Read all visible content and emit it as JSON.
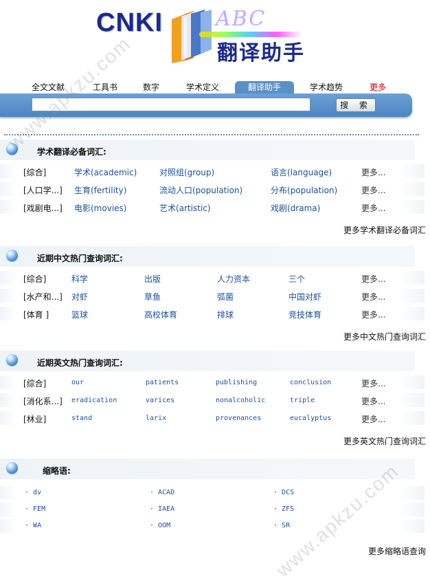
{
  "logo": {
    "brand": "CNKI",
    "abc": "ABC",
    "subtitle": "翻译助手"
  },
  "nav": {
    "tabs": [
      {
        "label": "全文文献"
      },
      {
        "label": "工具书"
      },
      {
        "label": "数字"
      },
      {
        "label": "学术定义"
      },
      {
        "label": "翻译助手",
        "active": true
      },
      {
        "label": "学术趋势"
      },
      {
        "label": "更多"
      }
    ]
  },
  "search": {
    "value": "",
    "button_label": "搜 索"
  },
  "sections": [
    {
      "title": "学术翻译必备词汇:",
      "rows": [
        {
          "category": "[综合]",
          "terms": [
            "学术(academic)",
            "对照组(group)",
            "语言(language)"
          ],
          "more": "更多..."
        },
        {
          "category": "[人口学...]",
          "terms": [
            "生育(fertility)",
            "流动人口(population)",
            "分布(population)"
          ],
          "more": "更多..."
        },
        {
          "category": "[戏剧电...]",
          "terms": [
            "电影(movies)",
            "艺术(artistic)",
            "戏剧(drama)"
          ],
          "more": "更多..."
        }
      ],
      "more_link": "更多学术翻译必备词汇"
    },
    {
      "title": "近期中文热门查询词汇:",
      "rows": [
        {
          "category": "[综合]",
          "terms": [
            "科学",
            "出版",
            "人力资本",
            "三个"
          ],
          "more": "更多..."
        },
        {
          "category": "[水产和...]",
          "terms": [
            "对虾",
            "草鱼",
            "弧菌",
            "中国对虾"
          ],
          "more": "更多..."
        },
        {
          "category": "[体育 ]",
          "terms": [
            "篮球",
            "高校体育",
            "排球",
            "竞技体育"
          ],
          "more": "更多..."
        }
      ],
      "more_link": "更多中文热门查询词汇"
    },
    {
      "title": "近期英文热门查询词汇:",
      "rows": [
        {
          "category": "[综合]",
          "terms": [
            "our",
            "patients",
            "publishing",
            "conclusion"
          ],
          "more": "更多..."
        },
        {
          "category": "[消化系...]",
          "terms": [
            "eradication",
            "varices",
            "nonalcoholic",
            "triple"
          ],
          "more": "更多..."
        },
        {
          "category": "[林业]",
          "terms": [
            "stand",
            "larix",
            "provenances",
            "eucalyptus"
          ],
          "more": "更多..."
        }
      ],
      "more_link": "更多英文热门查询词汇"
    },
    {
      "title": "缩略语:",
      "rows": [
        {
          "items": [
            "dv",
            "ACAD",
            "DCS"
          ]
        },
        {
          "items": [
            "FEM",
            "IAEA",
            "ZFS"
          ]
        },
        {
          "items": [
            "WA",
            "OOM",
            "SR"
          ]
        }
      ],
      "more_link": "更多缩略语查询"
    }
  ],
  "watermark": "www.apkzu.com"
}
